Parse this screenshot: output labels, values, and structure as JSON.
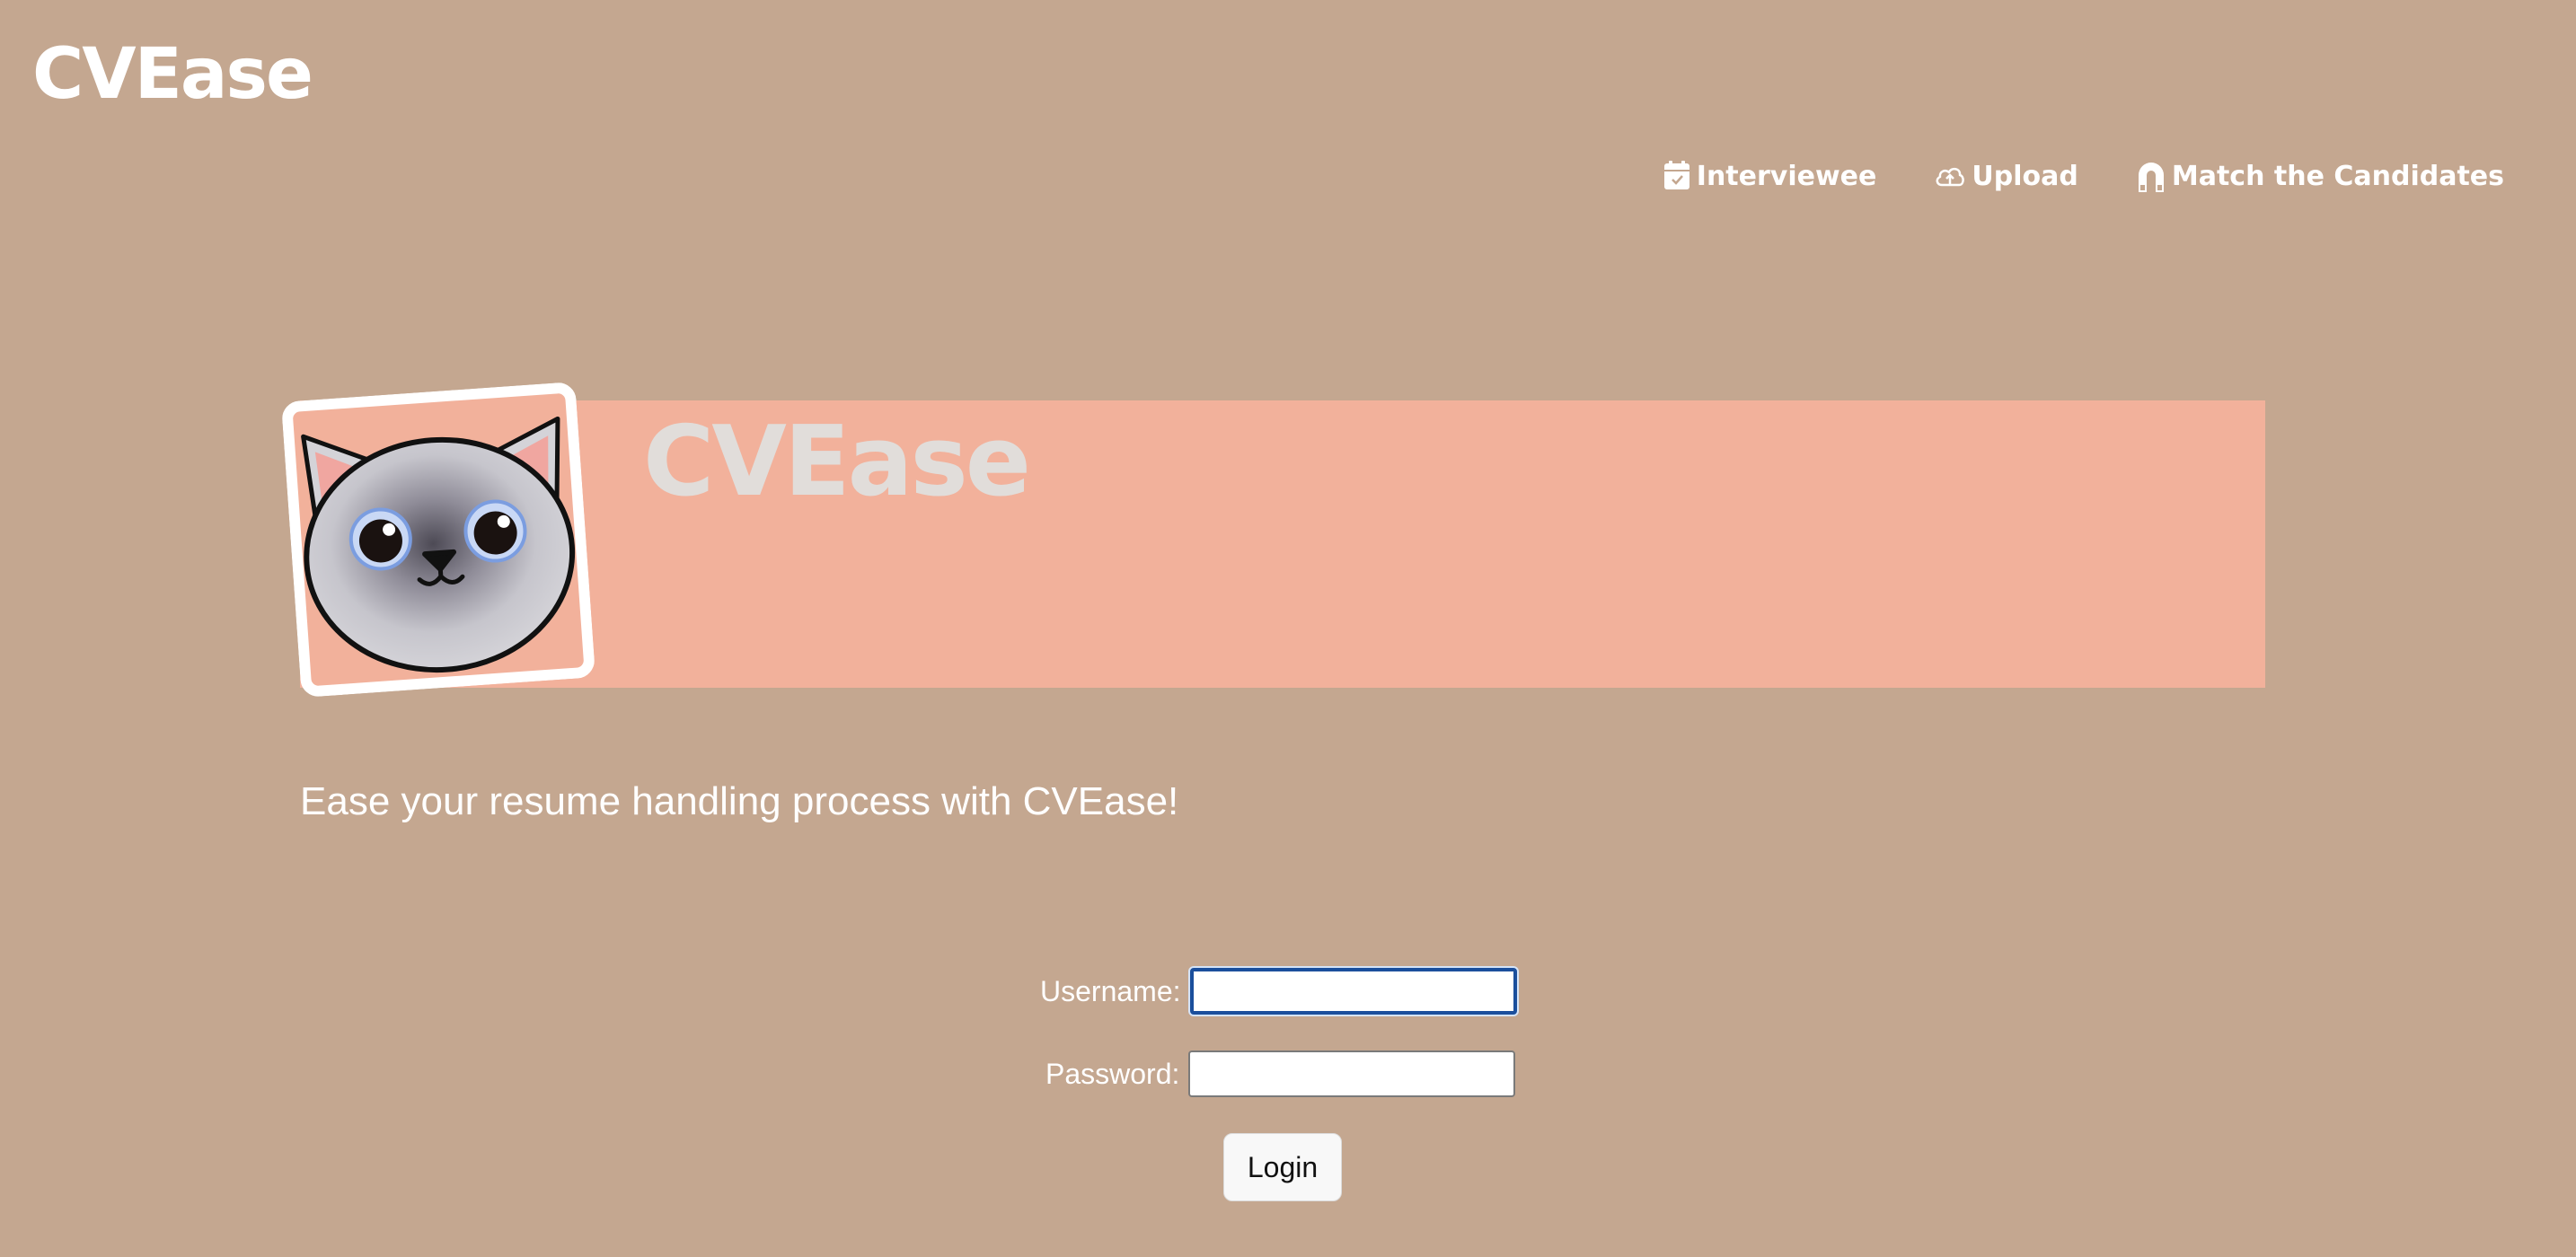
{
  "app": {
    "brand": "CVEase"
  },
  "nav": {
    "items": [
      {
        "label": "Interviewee",
        "icon": "calendar-check-icon"
      },
      {
        "label": "Upload",
        "icon": "cloud-upload-icon"
      },
      {
        "label": "Match the Candidates",
        "icon": "magnet-icon"
      }
    ]
  },
  "hero": {
    "title": "CVEase",
    "avatar": "cat-avatar"
  },
  "tagline": "Ease your resume handling process with CVEase!",
  "login": {
    "username_label": "Username:",
    "username_value": "",
    "password_label": "Password:",
    "password_value": "",
    "button_label": "Login"
  },
  "colors": {
    "background": "#c4a790",
    "hero_banner": "#f2b19b",
    "hero_title": "#e1ddda",
    "text": "#ffffff",
    "input_focus": "#1b4f9c"
  }
}
